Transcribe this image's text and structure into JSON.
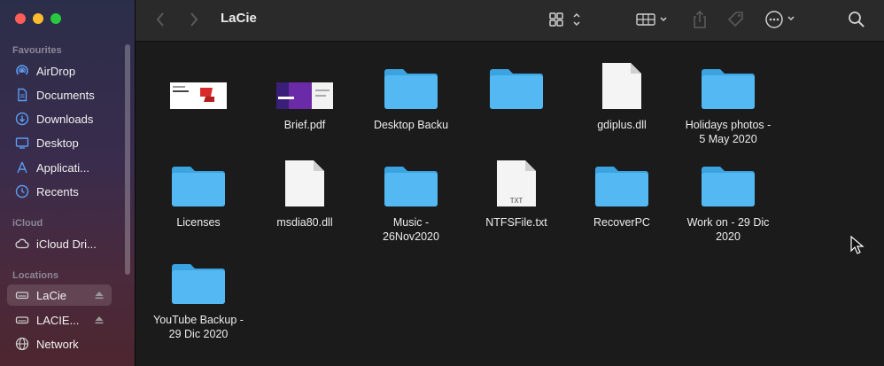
{
  "window": {
    "title": "LaCie",
    "traffic_lights": [
      "#ff5f57",
      "#febc2e",
      "#28c840"
    ]
  },
  "sidebar": {
    "favourites_title": "Favourites",
    "favourites": [
      {
        "label": "AirDrop",
        "icon": "airdrop-icon"
      },
      {
        "label": "Documents",
        "icon": "document-icon"
      },
      {
        "label": "Downloads",
        "icon": "download-icon"
      },
      {
        "label": "Desktop",
        "icon": "desktop-icon"
      },
      {
        "label": "Applicati...",
        "icon": "applications-icon"
      },
      {
        "label": "Recents",
        "icon": "clock-icon"
      }
    ],
    "icloud_title": "iCloud",
    "icloud": [
      {
        "label": "iCloud Dri...",
        "icon": "cloud-icon"
      }
    ],
    "locations_title": "Locations",
    "locations": [
      {
        "label": "LaCie",
        "icon": "drive-icon",
        "selected": true
      },
      {
        "label": "LACIE...",
        "icon": "drive-icon"
      },
      {
        "label": "Network",
        "icon": "globe-icon"
      }
    ]
  },
  "toolbar": {
    "back": "chevron-left-icon",
    "forward": "chevron-right-icon",
    "view": "grid-view-icon",
    "group": "group-icon",
    "share": "share-icon",
    "tag": "tag-icon",
    "more": "ellipsis-icon",
    "search": "search-icon"
  },
  "files": [
    {
      "name": "",
      "kind": "image-preview"
    },
    {
      "name": "Brief.pdf",
      "kind": "pdf-preview"
    },
    {
      "name": "Desktop Backu",
      "kind": "folder"
    },
    {
      "name": "",
      "kind": "folder"
    },
    {
      "name": "gdiplus.dll",
      "kind": "document"
    },
    {
      "name": "Holidays photos -\n5 May 2020",
      "kind": "folder"
    },
    {
      "name": "Licenses",
      "kind": "folder"
    },
    {
      "name": "msdia80.dll",
      "kind": "document"
    },
    {
      "name": "Music -\n26Nov2020",
      "kind": "folder"
    },
    {
      "name": "NTFSFile.txt",
      "kind": "text-document",
      "badge": "TXT"
    },
    {
      "name": "RecoverPC",
      "kind": "folder"
    },
    {
      "name": "Work on - 29 Dic\n2020",
      "kind": "folder"
    },
    {
      "name": "YouTube Backup -\n29 Dic 2020",
      "kind": "folder"
    }
  ],
  "colors": {
    "accent_folder": "#4fb4ef",
    "sidebar_selection": "#3c3a4a"
  }
}
